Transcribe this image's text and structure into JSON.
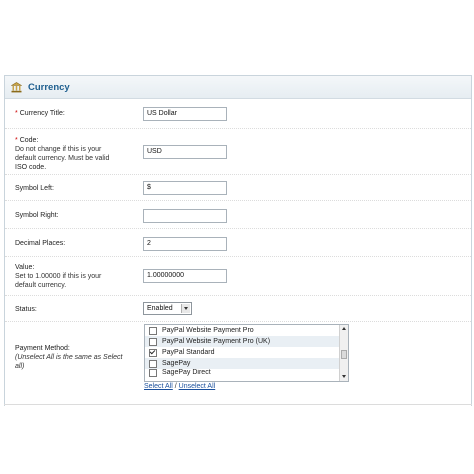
{
  "header": {
    "title": "Currency",
    "icon": "bank-icon"
  },
  "fields": {
    "currency_title": {
      "required_mark": "*",
      "label": "Currency Title:",
      "value": "US Dollar"
    },
    "code": {
      "required_mark": "*",
      "label": "Code:",
      "help_line1": "Do not change if this is your",
      "help_line2": "default currency. Must be valid",
      "help_link": "ISO code",
      "help_end": ".",
      "value": "USD"
    },
    "symbol_left": {
      "label": "Symbol Left:",
      "value": "$"
    },
    "symbol_right": {
      "label": "Symbol Right:",
      "value": ""
    },
    "decimal_places": {
      "label": "Decimal Places:",
      "value": "2"
    },
    "value": {
      "label": "Value:",
      "help_line1": "Set to 1.00000 if this is your",
      "help_line2": "default currency.",
      "value": "1.00000000"
    },
    "status": {
      "label": "Status:",
      "selected": "Enabled"
    },
    "payment_method": {
      "label": "Payment Method:",
      "help_line1": "(Unselect All is the same as Select",
      "help_line2": "all)",
      "items": [
        {
          "label": "PayPal Website Payment Pro",
          "checked": false
        },
        {
          "label": "PayPal Website Payment Pro (UK)",
          "checked": false
        },
        {
          "label": "PayPal Standard",
          "checked": true
        },
        {
          "label": "SagePay",
          "checked": false
        },
        {
          "label": "SagePay Direct",
          "checked": false
        }
      ],
      "select_all": "Select All",
      "separator": " / ",
      "unselect_all": "Unselect All"
    }
  }
}
